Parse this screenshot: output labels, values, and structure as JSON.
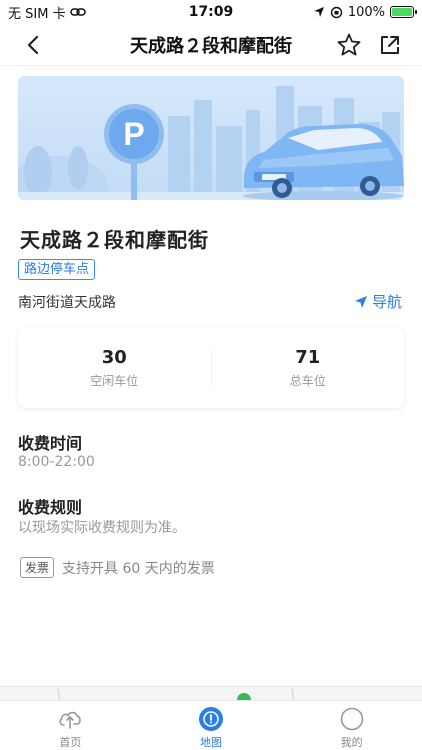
{
  "status_bar": {
    "carrier": "无 SIM 卡",
    "time": "17:09",
    "battery": "100%"
  },
  "nav": {
    "title": "天成路２段和摩配街",
    "back_icon": "chevron-left-icon",
    "favorite_icon": "star-icon",
    "share_icon": "share-icon"
  },
  "banner": {
    "sign_letter": "P"
  },
  "parking": {
    "name": "天成路２段和摩配街",
    "tag": "路边停车点",
    "address": "南河街道天成路",
    "navigate_label": "导航"
  },
  "stats": {
    "free": {
      "value": "30",
      "label": "空闲车位"
    },
    "total": {
      "value": "71",
      "label": "总车位"
    }
  },
  "fee_time": {
    "title": "收费时间",
    "value": "8:00-22:00"
  },
  "fee_rule": {
    "title": "收费规则",
    "value": "以现场实际收费规则为准。"
  },
  "invoice": {
    "badge": "发票",
    "text": "支持开具 60 天内的发票"
  },
  "tabs": [
    {
      "label": "首页",
      "icon": "cloud-icon",
      "active": false
    },
    {
      "label": "地图",
      "icon": "map-pin-icon",
      "active": true
    },
    {
      "label": "我的",
      "icon": "profile-icon",
      "active": false
    }
  ],
  "colors": {
    "accent": "#2a7ee8",
    "banner_bg": "#cfe3f8",
    "car_body": "#7fb6f4"
  }
}
